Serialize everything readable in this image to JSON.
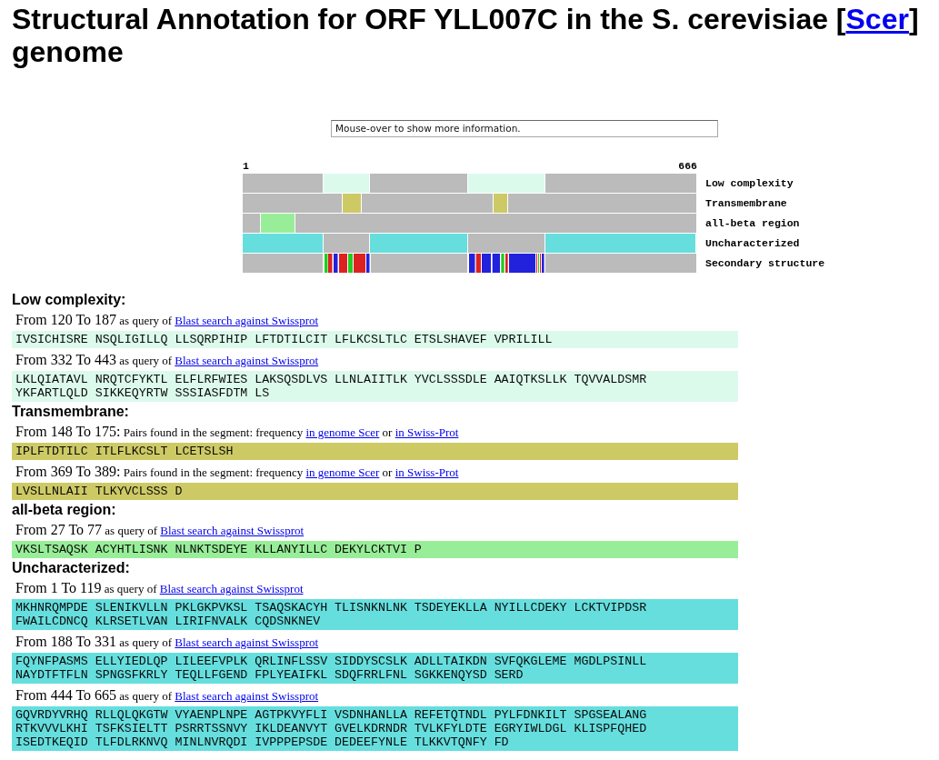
{
  "title": [
    {
      "kind": "text",
      "value": "Structural Annotation for ORF YLL007C in the S. cerevisiae ["
    },
    {
      "kind": "link",
      "value": "Scer"
    },
    {
      "kind": "text",
      "value": "] genome"
    }
  ],
  "info_box": {
    "value": "Mouse-over to show more information."
  },
  "scale": {
    "start": "1",
    "end": "666"
  },
  "tracks": [
    {
      "label": "Low complexity",
      "kind": "feature"
    },
    {
      "label": "Transmembrane",
      "kind": "feature"
    },
    {
      "label": "all-beta region",
      "kind": "feature"
    },
    {
      "label": "Uncharacterized",
      "kind": "feature"
    },
    {
      "label": "Secondary structure",
      "kind": "secondary"
    }
  ],
  "sections": [
    {
      "heading": "Low complexity:",
      "color": "#dcfaec",
      "entries": [
        {
          "range": "From 120 To 187",
          "parts": [
            {
              "kind": "text",
              "value": "as query of"
            },
            {
              "kind": "link",
              "value": "Blast search against Swissprot"
            }
          ],
          "sequence": "IVSICHISRE NSQLIGILLQ LLSQRPIHIP LFTDTILCIT LFLKCSLTLC ETSLSHAVEF VPRILILL"
        },
        {
          "range": "From 332 To 443",
          "parts": [
            {
              "kind": "text",
              "value": "as query of"
            },
            {
              "kind": "link",
              "value": "Blast search against Swissprot"
            }
          ],
          "sequence": "LKLQIATAVL NRQTCFYKTL ELFLRFWIES LAKSQSDLVS LLNLAIITLK YVCLSSSDLE AAIQTKSLLK TQVVALDSMR\nYKFARTLQLD SIKKEQYRTW SSSIASFDTM LS"
        }
      ]
    },
    {
      "heading": "Transmembrane:",
      "color": "#cdca66",
      "entries": [
        {
          "range": "From 148 To 175:",
          "parts": [
            {
              "kind": "text",
              "value": "Pairs found in the segment: frequency"
            },
            {
              "kind": "link",
              "value": "in genome Scer"
            },
            {
              "kind": "text",
              "value": "or"
            },
            {
              "kind": "link",
              "value": "in Swiss-Prot"
            }
          ],
          "sequence": "IPLFTDTILC ITLFLKCSLT LCETSLSH"
        },
        {
          "range": "From 369 To 389:",
          "parts": [
            {
              "kind": "text",
              "value": "Pairs found in the segment: frequency"
            },
            {
              "kind": "link",
              "value": "in genome Scer"
            },
            {
              "kind": "text",
              "value": "or"
            },
            {
              "kind": "link",
              "value": "in Swiss-Prot"
            }
          ],
          "sequence": "LVSLLNLAII TLKYVCLSSS D"
        }
      ]
    },
    {
      "heading": "all-beta region:",
      "color": "#98ee98",
      "entries": [
        {
          "range": "From 27 To 77",
          "parts": [
            {
              "kind": "text",
              "value": "as query of"
            },
            {
              "kind": "link",
              "value": "Blast search against Swissprot"
            }
          ],
          "sequence": "VKSLTSAQSK ACYHTLISNK NLNKTSDEYE KLLANYILLC DEKYLCKTVI P"
        }
      ]
    },
    {
      "heading": "Uncharacterized:",
      "color": "#66dede",
      "entries": [
        {
          "range": "From 1 To 119",
          "parts": [
            {
              "kind": "text",
              "value": "as query of"
            },
            {
              "kind": "link",
              "value": "Blast search against Swissprot"
            }
          ],
          "sequence": "MKHNRQMPDE SLENIKVLLN PKLGKPVKSL TSAQSKACYH TLISNKNLNK TSDEYEKLLA NYILLCDEKY LCKTVIPDSR\nFWAILCDNCQ KLRSETLVAN LIRIFNVALK CQDSNKNEV"
        },
        {
          "range": "From 188 To 331",
          "parts": [
            {
              "kind": "text",
              "value": "as query of"
            },
            {
              "kind": "link",
              "value": "Blast search against Swissprot"
            }
          ],
          "sequence": "FQYNFPASMS ELLYIEDLQP LILEEFVPLK QRLINFLSSV SIDDYSCSLK ADLLTAIKDN SVFQKGLEME MGDLPSINLL\nNAYDTFTFLN SPNGSFKRLY TEQLLFGEND FPLYEAIFKL SDQFRRLFNL SGKKENQYSD SERD"
        },
        {
          "range": "From 444 To 665",
          "parts": [
            {
              "kind": "text",
              "value": "as query of"
            },
            {
              "kind": "link",
              "value": "Blast search against Swissprot"
            }
          ],
          "sequence": "GQVRDYVRHQ RLLQLQKGTW VYAENPLNPE AGTPKVYFLI VSDNHANLLA REFETQTNDL PYLFDNKILT SPGSEALANG\nRTKVVVLKHI TSFKSIELTT PSRRTSSNVY IKLDEANVYT GVELKDRNDR TVLKFYLDTE EGRYIWLDGL KLISPFQHED\nISEDTKEQID TLFDLRKNVQ MINLNVRQDI IVPPPEPSDE DEDEEFYNLE TLKKVTQNFY FD"
        }
      ]
    }
  ]
}
